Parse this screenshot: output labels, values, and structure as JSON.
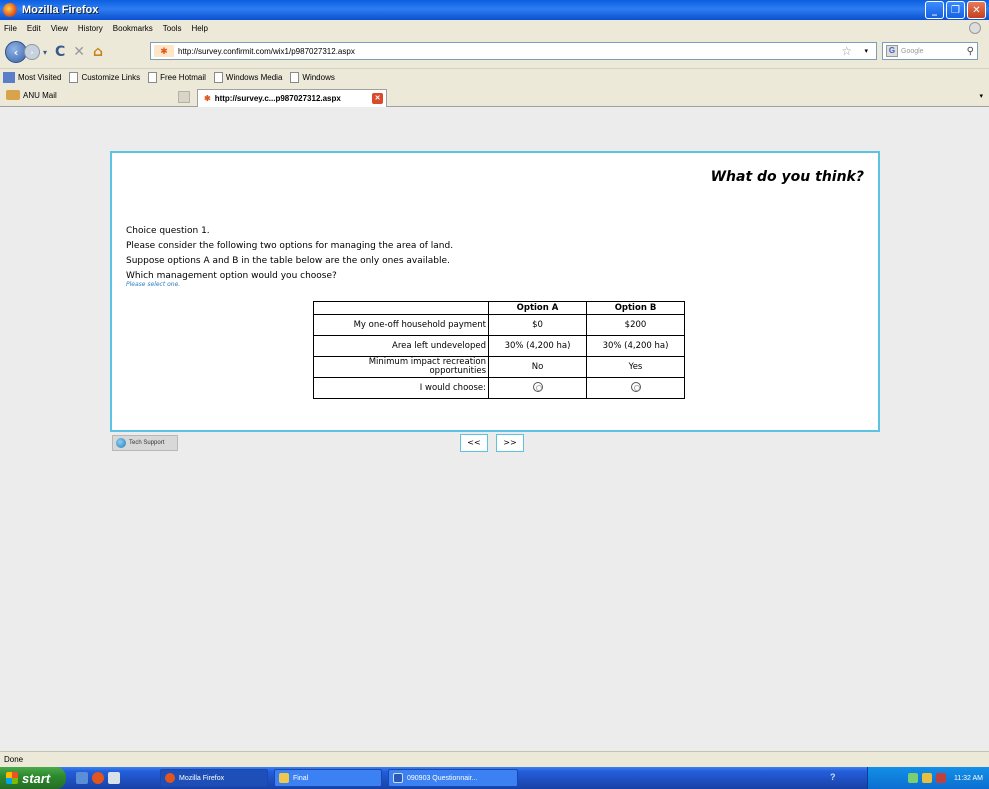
{
  "window": {
    "title": "Mozilla Firefox"
  },
  "menu": [
    "File",
    "Edit",
    "View",
    "History",
    "Bookmarks",
    "Tools",
    "Help"
  ],
  "nav": {
    "url": "http://survey.confirmit.com/wix1/p987027312.aspx",
    "search_placeholder": "Google"
  },
  "bookmarks": [
    "Most Visited",
    "Customize Links",
    "Free Hotmail",
    "Windows Media",
    "Windows"
  ],
  "tabs": [
    {
      "label": "ANU Mail"
    },
    {
      "label": "http://survey.c...p987027312.aspx"
    }
  ],
  "page": {
    "heading": "What do you think?",
    "question_lines": [
      "Choice question 1.",
      "Please consider the following two options for managing the area of land.",
      "Suppose options A and B in the table below are the only ones available.",
      "Which management option would you choose?"
    ],
    "instruction": "Please select one.",
    "table": {
      "headers": [
        "",
        "Option A",
        "Option B"
      ],
      "rows": [
        {
          "label": "My one-off household payment",
          "a": "$0",
          "b": "$200"
        },
        {
          "label": "Area left undeveloped",
          "a": "30% (4,200 ha)",
          "b": "30% (4,200 ha)"
        },
        {
          "label_1": "Minimum impact recreation",
          "label_2": "opportunities",
          "a": "No",
          "b": "Yes"
        }
      ],
      "choose_label": "I would choose:"
    },
    "tech_support": "Tech Support",
    "prev": "<<",
    "next": ">>"
  },
  "status": "Done",
  "taskbar": {
    "start": "start",
    "tasks": [
      "Mozilla Firefox",
      "Final",
      "090903 Questionnair..."
    ],
    "clock": "11:32 AM"
  }
}
